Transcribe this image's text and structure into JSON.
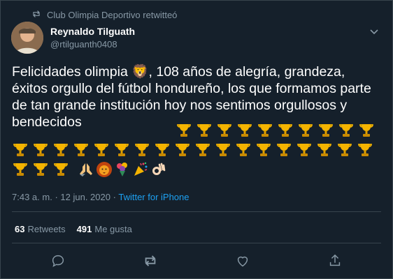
{
  "retweet_label": "Club Olimpia Deportivo retwitteó",
  "author": {
    "name": "Reynaldo Tilguath",
    "handle": "@rtilguanth0408"
  },
  "text": "Felicidades olimpia 🦁, 108 años de alegría, grandeza, éxitos orgullo del fútbol hondureño, los que formamos parte de tan grande institución hoy nos sentimos orgullosos y bendecidos",
  "emojis_trophies_line1": 10,
  "emojis_trophies_line2": 18,
  "emojis_trophies_line3": 3,
  "emoji_icons_tail": [
    "praying-hands-icon",
    "lion-icon",
    "bouquet-icon",
    "party-popper-icon",
    "ok-hand-icon"
  ],
  "meta": {
    "time": "7:43 a. m.",
    "sep": "·",
    "date": "12 jun. 2020",
    "app": "Twitter for iPhone"
  },
  "stats": {
    "retweets_count": "63",
    "retweets_label": "Retweets",
    "likes_count": "491",
    "likes_label": "Me gusta"
  },
  "colors": {
    "background": "#15202b",
    "muted": "#8899a6",
    "accent": "#1da1f2",
    "border": "#38444d"
  }
}
